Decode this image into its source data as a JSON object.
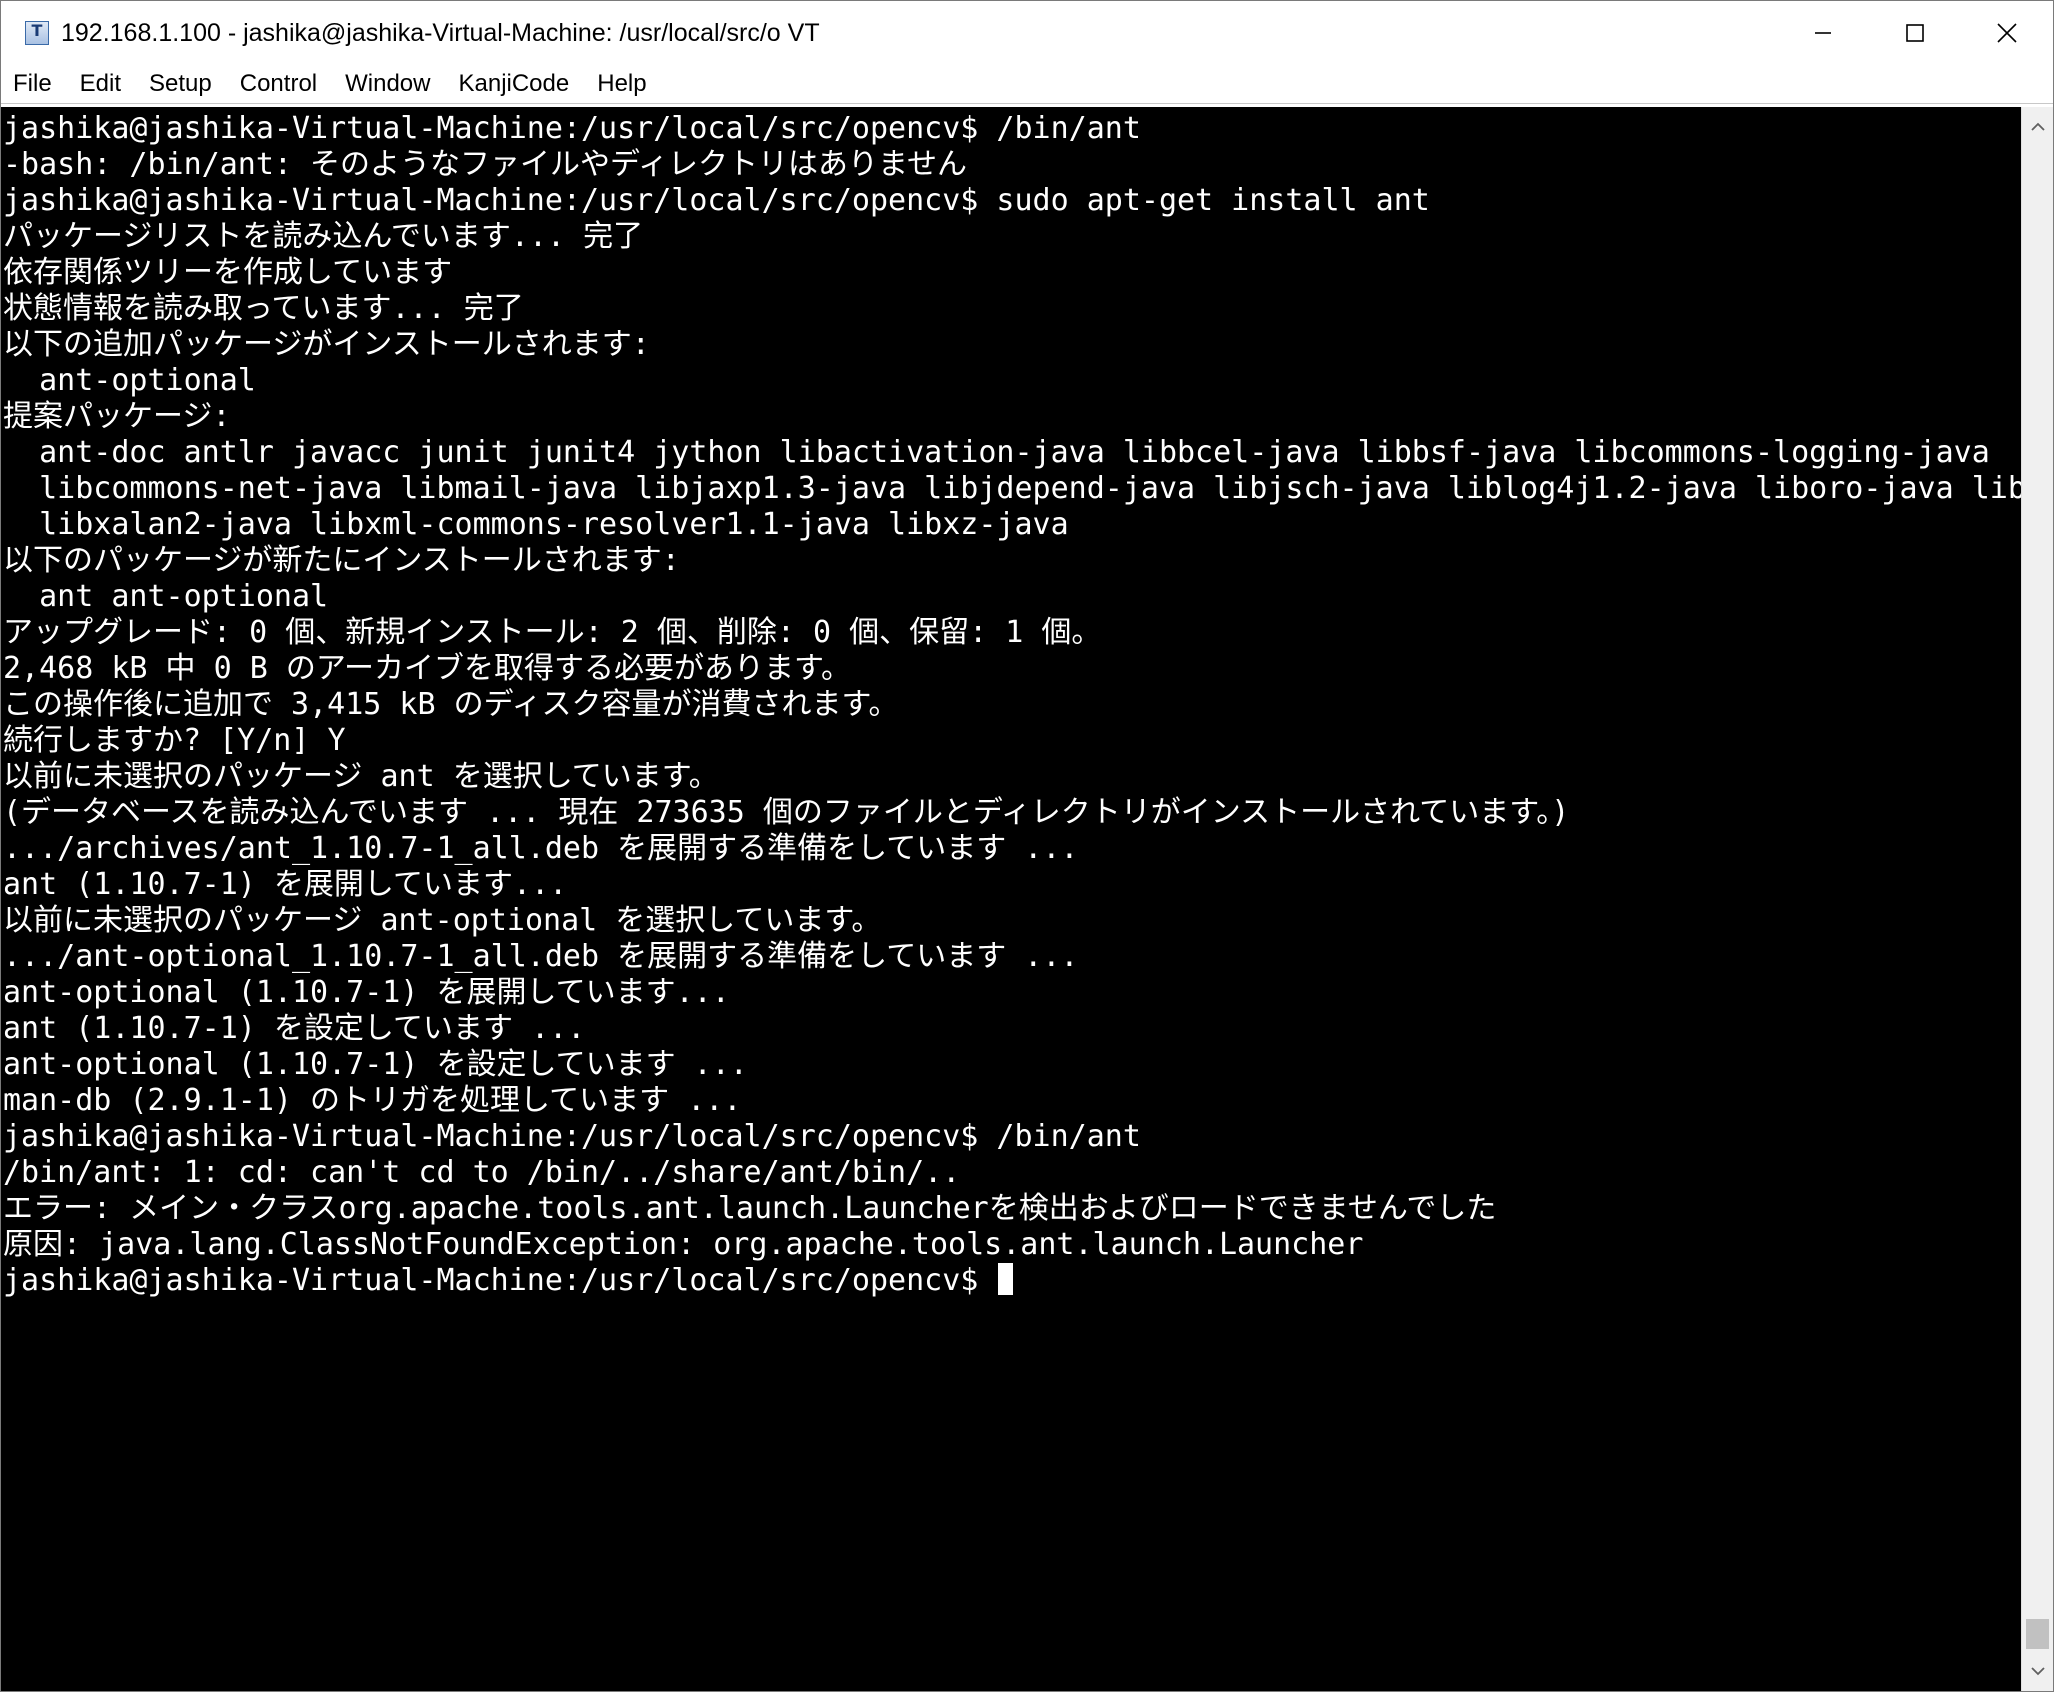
{
  "window": {
    "title": "192.168.1.100 - jashika@jashika-Virtual-Machine: /usr/local/src/o VT",
    "icon": "teraterm-app-icon"
  },
  "window_controls": {
    "minimize": "minimize-icon",
    "maximize": "maximize-icon",
    "close": "close-icon"
  },
  "menu": {
    "items": [
      {
        "label": "File"
      },
      {
        "label": "Edit"
      },
      {
        "label": "Setup"
      },
      {
        "label": "Control"
      },
      {
        "label": "Window"
      },
      {
        "label": "KanjiCode"
      },
      {
        "label": "Help"
      }
    ]
  },
  "terminal": {
    "background": "#000000",
    "foreground": "#ffffff",
    "lines": [
      "jashika@jashika-Virtual-Machine:/usr/local/src/opencv$ /bin/ant",
      "-bash: /bin/ant: そのようなファイルやディレクトリはありません",
      "jashika@jashika-Virtual-Machine:/usr/local/src/opencv$ sudo apt-get install ant",
      "パッケージリストを読み込んでいます... 完了",
      "依存関係ツリーを作成しています",
      "状態情報を読み取っています... 完了",
      "以下の追加パッケージがインストールされます:",
      "  ant-optional",
      "提案パッケージ:",
      "  ant-doc antlr javacc junit junit4 jython libactivation-java libbcel-java libbsf-java libcommons-logging-java",
      "  libcommons-net-java libmail-java libjaxp1.3-java libjdepend-java libjsch-java liblog4j1.2-java liboro-java libregexp-java",
      "  libxalan2-java libxml-commons-resolver1.1-java libxz-java",
      "以下のパッケージが新たにインストールされます:",
      "  ant ant-optional",
      "アップグレード: 0 個、新規インストール: 2 個、削除: 0 個、保留: 1 個。",
      "2,468 kB 中 0 B のアーカイブを取得する必要があります。",
      "この操作後に追加で 3,415 kB のディスク容量が消費されます。",
      "続行しますか? [Y/n] Y",
      "以前に未選択のパッケージ ant を選択しています。",
      "(データベースを読み込んでいます ... 現在 273635 個のファイルとディレクトリがインストールされています。)",
      ".../archives/ant_1.10.7-1_all.deb を展開する準備をしています ...",
      "ant (1.10.7-1) を展開しています...",
      "以前に未選択のパッケージ ant-optional を選択しています。",
      ".../ant-optional_1.10.7-1_all.deb を展開する準備をしています ...",
      "ant-optional (1.10.7-1) を展開しています...",
      "ant (1.10.7-1) を設定しています ...",
      "ant-optional (1.10.7-1) を設定しています ...",
      "man-db (2.9.1-1) のトリガを処理しています ...",
      "jashika@jashika-Virtual-Machine:/usr/local/src/opencv$ /bin/ant",
      "/bin/ant: 1: cd: can't cd to /bin/../share/ant/bin/..",
      "エラー: メイン・クラスorg.apache.tools.ant.launch.Launcherを検出およびロードできませんでした",
      "原因: java.lang.ClassNotFoundException: org.apache.tools.ant.launch.Launcher"
    ],
    "prompt": "jashika@jashika-Virtual-Machine:/usr/local/src/opencv$ "
  },
  "scrollbar": {
    "up_arrow": "chevron-up-icon",
    "down_arrow": "chevron-down-icon",
    "position": 1.0
  }
}
